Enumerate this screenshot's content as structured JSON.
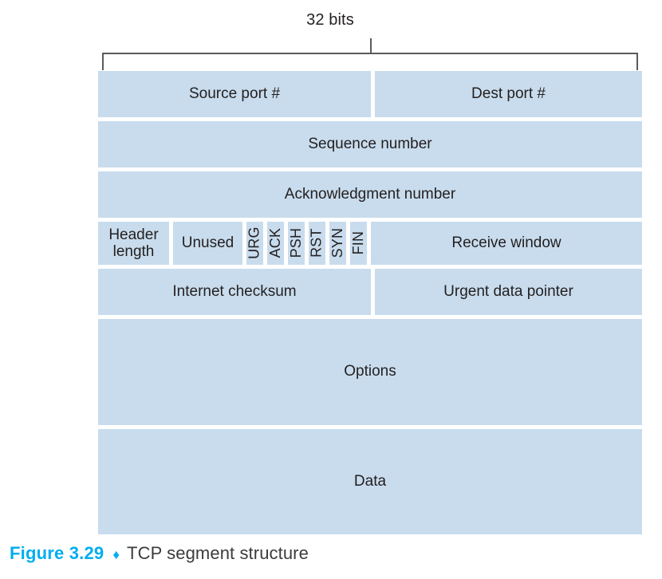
{
  "figure": {
    "width_annotation": "32 bits",
    "rows": [
      {
        "name": "ports",
        "cells": [
          {
            "label": "Source port #"
          },
          {
            "label": "Dest port #"
          }
        ]
      },
      {
        "name": "sequence-number",
        "cells": [
          {
            "label": "Sequence number"
          }
        ]
      },
      {
        "name": "acknowledgment-number",
        "cells": [
          {
            "label": "Acknowledgment number"
          }
        ]
      },
      {
        "name": "flags",
        "cells": [
          {
            "label": "Header length"
          },
          {
            "label": "Unused"
          },
          {
            "label": "URG"
          },
          {
            "label": "ACK"
          },
          {
            "label": "PSH"
          },
          {
            "label": "RST"
          },
          {
            "label": "SYN"
          },
          {
            "label": "FIN"
          },
          {
            "label": "Receive window"
          }
        ]
      },
      {
        "name": "checksum",
        "cells": [
          {
            "label": "Internet checksum"
          },
          {
            "label": "Urgent data pointer"
          }
        ]
      },
      {
        "name": "options",
        "cells": [
          {
            "label": "Options"
          }
        ]
      },
      {
        "name": "data",
        "cells": [
          {
            "label": "Data"
          }
        ]
      }
    ],
    "header_length_line1": "Header",
    "header_length_line2": "length"
  },
  "caption": {
    "figure_number": "Figure 3.29",
    "separator": "♦",
    "title": "TCP segment structure"
  },
  "colors": {
    "cell_fill": "#c8dced",
    "accent": "#00aeef",
    "rule": "#5b5b5f",
    "text": "#231f20"
  }
}
